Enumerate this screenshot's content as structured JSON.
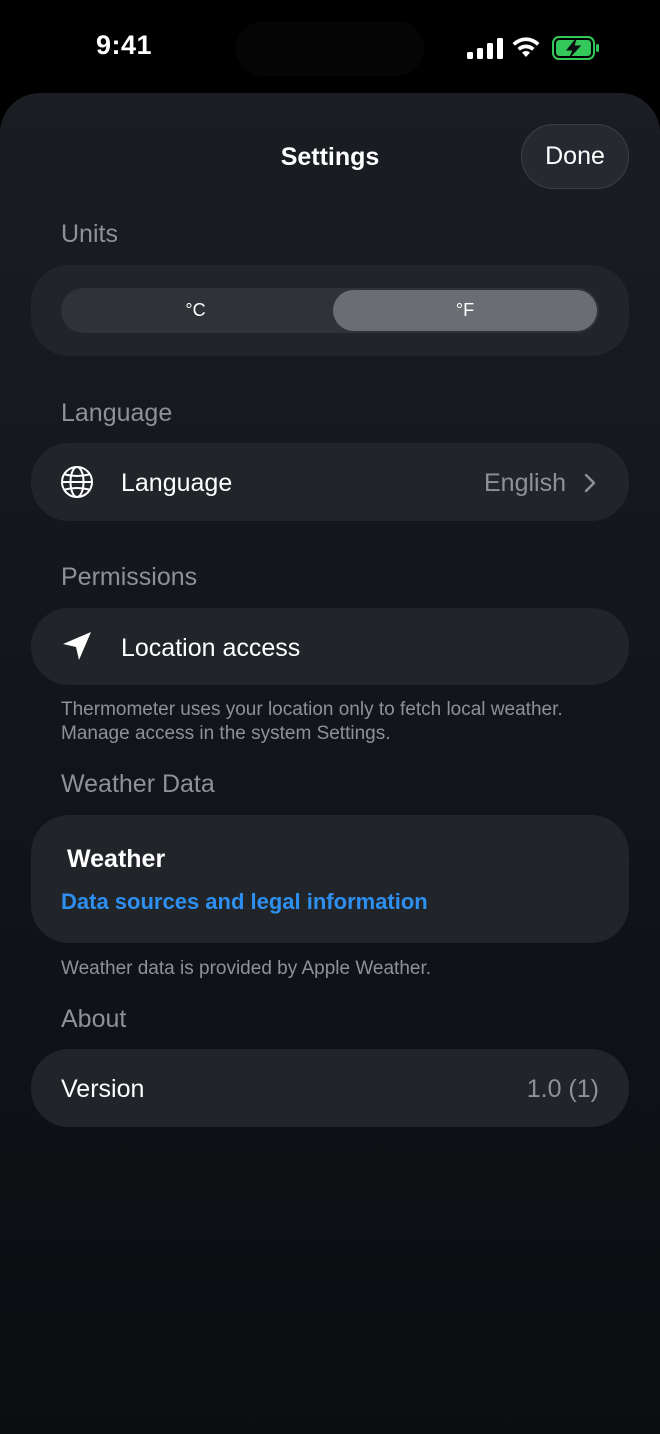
{
  "status_bar": {
    "time": "9:41",
    "icons": [
      "cellular-signal-icon",
      "wifi-icon",
      "battery-charging-icon"
    ],
    "battery_color": "#34c759"
  },
  "sheet": {
    "title": "Settings",
    "done_label": "Done"
  },
  "units": {
    "header": "Units",
    "options": [
      "°C",
      "°F"
    ],
    "selected": "°F"
  },
  "language": {
    "header": "Language",
    "label": "Language",
    "value": "English",
    "icon": "globe-icon"
  },
  "permissions": {
    "header": "Permissions",
    "label": "Location access",
    "icon": "location-arrow-icon",
    "footnote": "Thermometer uses your location only to fetch local weather. Manage access in the system Settings."
  },
  "weather_data": {
    "header": "Weather Data",
    "brand": "Weather",
    "brand_icon": "apple-logo-icon",
    "link": "Data sources and legal information",
    "link_color": "#2d8ff0",
    "footnote": "Weather data is provided by Apple Weather."
  },
  "about": {
    "header": "About",
    "label": "Version",
    "value": "1.0 (1)"
  }
}
